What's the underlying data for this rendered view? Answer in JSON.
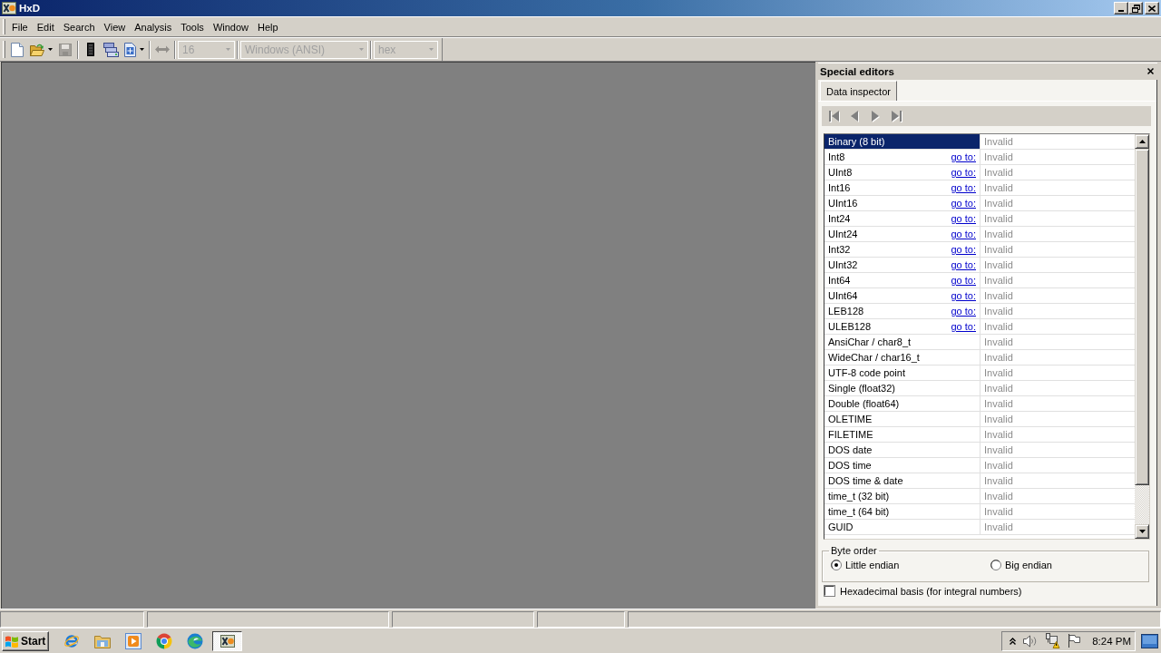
{
  "window": {
    "title": "HxD"
  },
  "menu": [
    "File",
    "Edit",
    "Search",
    "View",
    "Analysis",
    "Tools",
    "Window",
    "Help"
  ],
  "toolbar": {
    "buttons": [
      {
        "disabled": false,
        "dropdown": false
      },
      {
        "disabled": false,
        "dropdown": true
      },
      {
        "disabled": true,
        "dropdown": false
      },
      {
        "disabled": false,
        "dropdown": false
      },
      {
        "disabled": false,
        "dropdown": false
      },
      {
        "disabled": false,
        "dropdown": true
      },
      {
        "disabled": true,
        "dropdown": false
      }
    ],
    "combos": [
      {
        "value": "16",
        "disabled": true
      },
      {
        "value": "Windows (ANSI)",
        "disabled": true
      },
      {
        "value": "hex",
        "disabled": true
      }
    ]
  },
  "special_editors": {
    "title": "Special editors",
    "tabs": [
      {
        "label": "Data inspector",
        "selected": true
      }
    ],
    "nav_buttons": [
      {
        "disabled": true
      },
      {
        "disabled": true
      },
      {
        "disabled": true
      },
      {
        "disabled": true
      }
    ],
    "rows": [
      {
        "name": "Binary (8 bit)",
        "value": "Invalid",
        "selected": true
      },
      {
        "name": "Int8",
        "link": "go to:",
        "value": "Invalid",
        "selected": false
      },
      {
        "name": "UInt8",
        "link": "go to:",
        "value": "Invalid",
        "selected": false
      },
      {
        "name": "Int16",
        "link": "go to:",
        "value": "Invalid",
        "selected": false
      },
      {
        "name": "UInt16",
        "link": "go to:",
        "value": "Invalid",
        "selected": false
      },
      {
        "name": "Int24",
        "link": "go to:",
        "value": "Invalid",
        "selected": false
      },
      {
        "name": "UInt24",
        "link": "go to:",
        "value": "Invalid",
        "selected": false
      },
      {
        "name": "Int32",
        "link": "go to:",
        "value": "Invalid",
        "selected": false
      },
      {
        "name": "UInt32",
        "link": "go to:",
        "value": "Invalid",
        "selected": false
      },
      {
        "name": "Int64",
        "link": "go to:",
        "value": "Invalid",
        "selected": false
      },
      {
        "name": "UInt64",
        "link": "go to:",
        "value": "Invalid",
        "selected": false
      },
      {
        "name": "LEB128",
        "link": "go to:",
        "value": "Invalid",
        "selected": false
      },
      {
        "name": "ULEB128",
        "link": "go to:",
        "value": "Invalid",
        "selected": false
      },
      {
        "name": "AnsiChar / char8_t",
        "value": "Invalid",
        "selected": false
      },
      {
        "name": "WideChar / char16_t",
        "value": "Invalid",
        "selected": false
      },
      {
        "name": "UTF-8 code point",
        "value": "Invalid",
        "selected": false
      },
      {
        "name": "Single (float32)",
        "value": "Invalid",
        "selected": false
      },
      {
        "name": "Double (float64)",
        "value": "Invalid",
        "selected": false
      },
      {
        "name": "OLETIME",
        "value": "Invalid",
        "selected": false
      },
      {
        "name": "FILETIME",
        "value": "Invalid",
        "selected": false
      },
      {
        "name": "DOS date",
        "value": "Invalid",
        "selected": false
      },
      {
        "name": "DOS time",
        "value": "Invalid",
        "selected": false
      },
      {
        "name": "DOS time & date",
        "value": "Invalid",
        "selected": false
      },
      {
        "name": "time_t (32 bit)",
        "value": "Invalid",
        "selected": false
      },
      {
        "name": "time_t (64 bit)",
        "value": "Invalid",
        "selected": false
      },
      {
        "name": "GUID",
        "value": "Invalid",
        "selected": false
      }
    ],
    "byte_order": {
      "label": "Byte order",
      "options": [
        {
          "label": "Little endian",
          "selected": true
        },
        {
          "label": "Big endian",
          "selected": false
        }
      ]
    },
    "hex_basis": {
      "label": "Hexadecimal basis (for integral numbers)",
      "checked": false
    }
  },
  "taskbar": {
    "start": "Start",
    "tasks": [
      {
        "active": true
      }
    ],
    "clock": "8:24 PM"
  }
}
